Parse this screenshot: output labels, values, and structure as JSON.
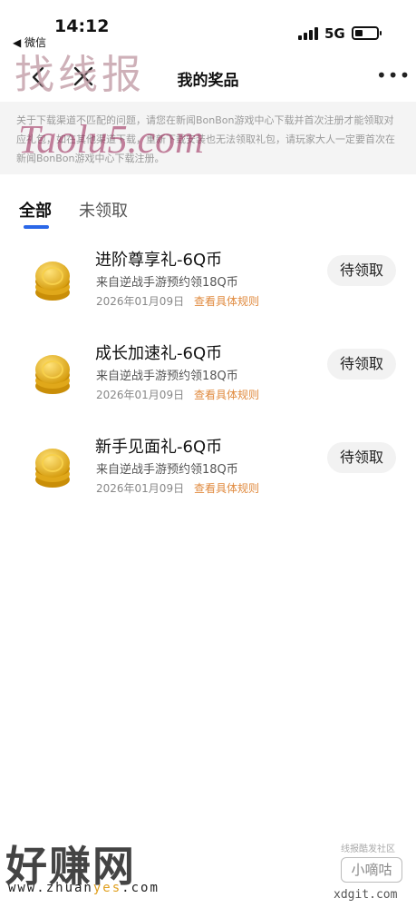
{
  "status_bar": {
    "time": "14:12",
    "back_app": "◀ 微信",
    "network": "5G"
  },
  "nav": {
    "title": "我的奖品",
    "more": "•••",
    "icons": [
      "back-chevron-icon",
      "close-icon",
      "more-icon"
    ]
  },
  "notice": {
    "text": "关于下载渠道不匹配的问题，请您在新闻BonBon游戏中心下载并首次注册才能领取对应礼包，如在其他渠道下载，重新下载安装也无法领取礼包，请玩家大人一定要首次在新闻BonBon游戏中心下载注册。"
  },
  "tabs": [
    {
      "label": "全部",
      "active": true
    },
    {
      "label": "未领取",
      "active": false
    }
  ],
  "prizes": [
    {
      "title": "进阶尊享礼-6Q币",
      "source": "来自逆战手游预约领18Q币",
      "date": "2026年01月09日",
      "rule_link": "查看具体规则",
      "button": "待领取"
    },
    {
      "title": "成长加速礼-6Q币",
      "source": "来自逆战手游预约领18Q币",
      "date": "2026年01月09日",
      "rule_link": "查看具体规则",
      "button": "待领取"
    },
    {
      "title": "新手见面礼-6Q币",
      "source": "来自逆战手游预约领18Q币",
      "date": "2026年01月09日",
      "rule_link": "查看具体规则",
      "button": "待领取"
    }
  ],
  "watermarks": {
    "top": "找线报",
    "taolu": "Taolu5.com",
    "bottom_left": "好赚网",
    "url_prefix": "www.zhuan",
    "url_highlight": "yes",
    "url_suffix": ".com",
    "badge_top": "线报酷发社区",
    "badge": "小嘀咕",
    "site": "xdgit.com"
  },
  "colors": {
    "accent_blue": "#2a67e8",
    "rule_link_orange": "#e08a3e",
    "notice_bg": "#f4f4f4",
    "button_bg": "#f2f2f2"
  }
}
